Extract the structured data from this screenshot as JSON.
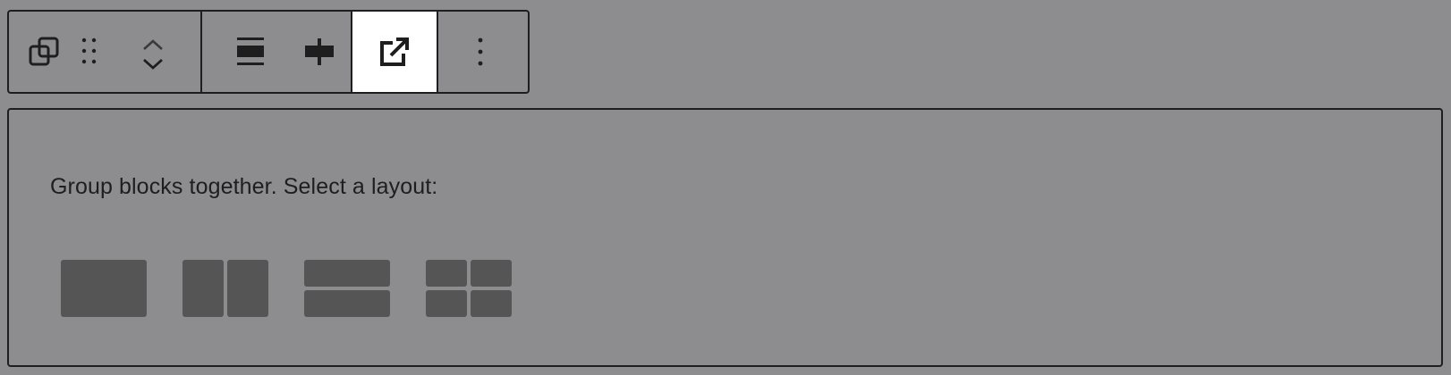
{
  "toolbar": {
    "buttons": [
      {
        "name": "duplicate-icon",
        "label": "Group"
      },
      {
        "name": "drag-handle-icon",
        "label": "Drag"
      },
      {
        "name": "move-up-icon",
        "label": "Move up"
      },
      {
        "name": "move-down-icon",
        "label": "Move down"
      },
      {
        "name": "align-wide-icon",
        "label": "Align"
      },
      {
        "name": "justify-center-icon",
        "label": "Justify"
      },
      {
        "name": "external-link-icon",
        "label": "Open",
        "active": true
      },
      {
        "name": "more-options-icon",
        "label": "Options"
      }
    ]
  },
  "group_placeholder": {
    "instruction": "Group blocks together. Select a layout:",
    "layout_options": [
      {
        "name": "layout-group",
        "cells": 1
      },
      {
        "name": "layout-row",
        "cells": 2
      },
      {
        "name": "layout-stack",
        "cells": 2
      },
      {
        "name": "layout-grid",
        "cells": 4
      }
    ]
  },
  "colors": {
    "background": "#8d8d8f",
    "border": "#1e1e1e",
    "active_button": "#ffffff",
    "layout_cell": "#555555"
  }
}
